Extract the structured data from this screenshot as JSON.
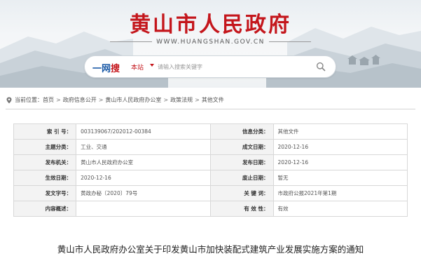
{
  "header": {
    "site_title": "黄山市人民政府",
    "site_url": "WWW.HUANGSHAN.GOV.CN"
  },
  "search": {
    "brand_prefix": "一网",
    "brand_suffix": "搜",
    "scope_label": "本站",
    "placeholder": "请输入搜索关键字"
  },
  "breadcrumb": {
    "prefix": "当前位置：",
    "items": [
      "首页",
      "政府信息公开",
      "黄山市人民政府办公室",
      "政策法规",
      "其他文件"
    ],
    "separator": ">"
  },
  "metadata": {
    "rows": [
      {
        "k1": "索 引 号：",
        "v1": "003139067/202012-00384",
        "k2": "信息分类：",
        "v2": "其他文件"
      },
      {
        "k1": "主题分类：",
        "v1": "工业、交通",
        "k2": "成文日期：",
        "v2": "2020-12-16"
      },
      {
        "k1": "发布机关：",
        "v1": "黄山市人民政府办公室",
        "k2": "发布日期：",
        "v2": "2020-12-16"
      },
      {
        "k1": "生效日期：",
        "v1": "2020-12-16",
        "k2": "废止日期：",
        "v2": "暂无"
      },
      {
        "k1": "发文字号：",
        "v1": "黄政办秘〔2020〕79号",
        "k2": "关 键 词：",
        "v2": "市政府公报2021年第1期"
      },
      {
        "k1": "内容概述：",
        "v1": "",
        "k2": "有 效 性：",
        "v2": "有效"
      }
    ]
  },
  "document": {
    "title": "黄山市人民政府办公室关于印发黄山市加快装配式建筑产业发展实施方案的通知"
  },
  "colors": {
    "brand_red": "#c4161c",
    "brand_blue": "#1b5aa7",
    "label_bg": "#f3f3f3"
  },
  "icons": {
    "search": "search-icon",
    "location": "location-icon"
  }
}
